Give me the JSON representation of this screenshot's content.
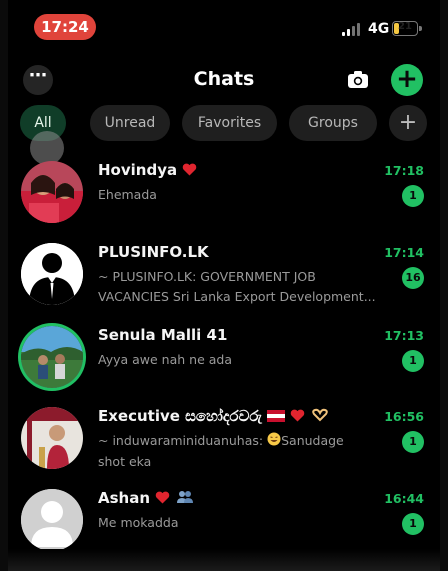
{
  "status_bar": {
    "time": "17:24",
    "network": "4G",
    "battery": "21",
    "battery_level": 0.21,
    "accent": "#e0443b"
  },
  "header": {
    "title": "Chats",
    "more_label": "⋯",
    "add_label": "+",
    "camera_icon": "camera-icon",
    "accent": "#21c063"
  },
  "filters": {
    "items": [
      "All",
      "Unread",
      "Favorites",
      "Groups"
    ],
    "selected": "All",
    "add_label": "+"
  },
  "chats": [
    {
      "name": "Hovindya",
      "time": "17:18",
      "line1": "Ehemada",
      "line2": "",
      "unread": "1"
    },
    {
      "name": "PLUSINFO.LK",
      "time": "17:14",
      "line1": "~ PLUSINFO.LK: GOVERNMENT JOB",
      "line2": "VACANCIES Sri Lanka Export Development...",
      "unread": "16"
    },
    {
      "name": "Senula Malli 41",
      "time": "17:13",
      "line1": "Ayya awe nah ne ada",
      "line2": "",
      "unread": "1"
    },
    {
      "name": "Executive සහෝදරවරු",
      "time": "16:56",
      "line1": "~ induwaraminiduanuhas:",
      "line1_suffix": "Sanudage",
      "line2": "shot eka",
      "unread": "1"
    },
    {
      "name": "Ashan",
      "time": "16:44",
      "line1": "Me mokadda",
      "line2": "",
      "unread": "1"
    }
  ]
}
